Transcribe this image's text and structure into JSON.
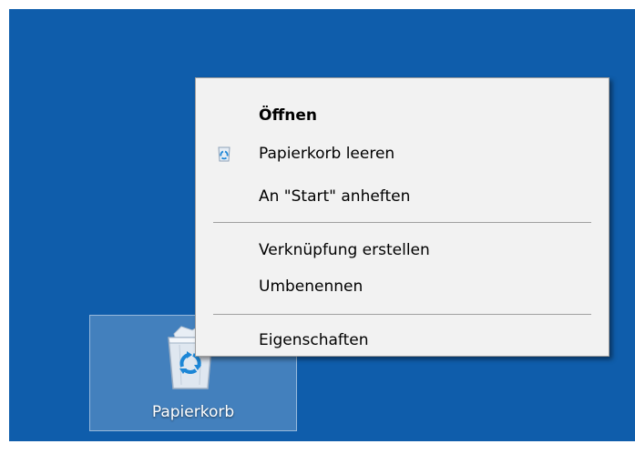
{
  "desktop": {
    "background_color": "#0f5dab",
    "icon": {
      "name": "recycle-bin-icon",
      "label": "Papierkorb"
    }
  },
  "context_menu": {
    "items": [
      {
        "label": "Öffnen",
        "bold": true,
        "icon": null
      },
      {
        "label": "Papierkorb leeren",
        "bold": false,
        "icon": "recycle-bin-small-icon"
      },
      {
        "label": "An \"Start\" anheften",
        "bold": false,
        "icon": null
      },
      {
        "separator": true
      },
      {
        "label": "Verknüpfung erstellen",
        "bold": false,
        "icon": null
      },
      {
        "label": "Umbenennen",
        "bold": false,
        "icon": null
      },
      {
        "separator": true
      },
      {
        "label": "Eigenschaften",
        "bold": false,
        "icon": null
      }
    ]
  }
}
